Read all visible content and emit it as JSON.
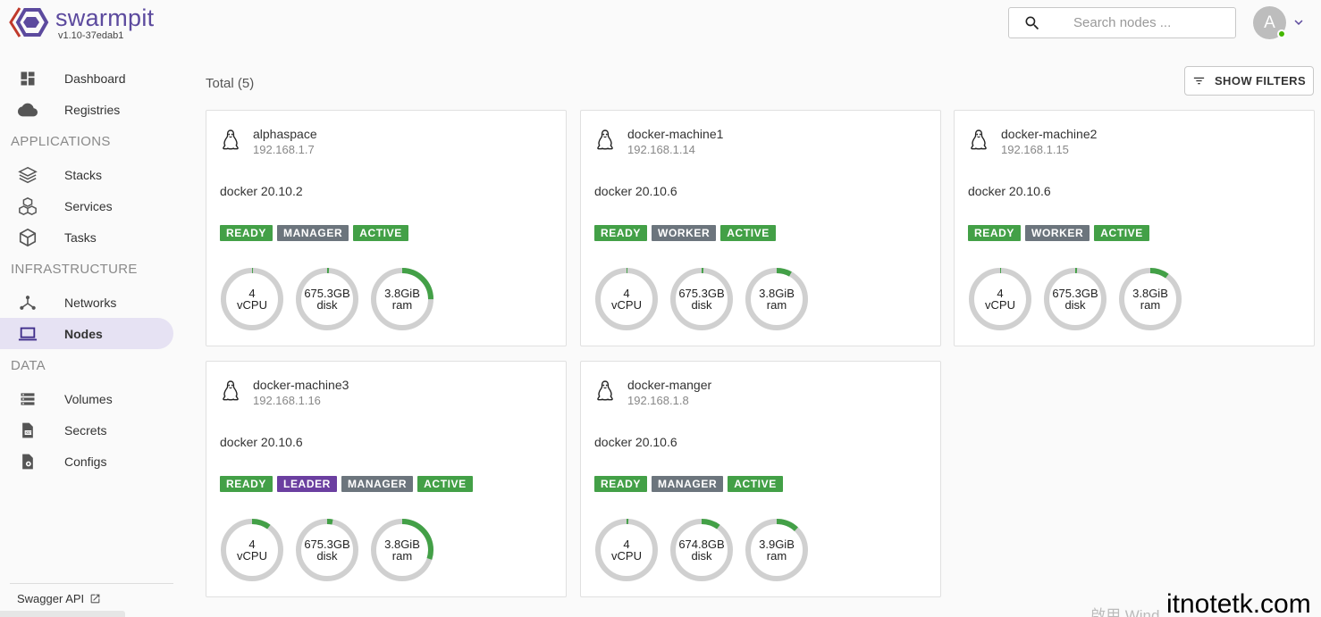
{
  "app": {
    "name": "swarmpit",
    "version": "v1.10-37edab1"
  },
  "sidebar": {
    "items": [
      {
        "type": "item",
        "label": "Dashboard",
        "icon": "dashboard-icon"
      },
      {
        "type": "item",
        "label": "Registries",
        "icon": "cloud-icon"
      },
      {
        "type": "section",
        "label": "APPLICATIONS"
      },
      {
        "type": "item",
        "label": "Stacks",
        "icon": "layers-icon"
      },
      {
        "type": "item",
        "label": "Services",
        "icon": "cubes-icon"
      },
      {
        "type": "item",
        "label": "Tasks",
        "icon": "cube-icon"
      },
      {
        "type": "section",
        "label": "INFRASTRUCTURE"
      },
      {
        "type": "item",
        "label": "Networks",
        "icon": "network-icon"
      },
      {
        "type": "item",
        "label": "Nodes",
        "icon": "laptop-icon",
        "active": true
      },
      {
        "type": "section",
        "label": "DATA"
      },
      {
        "type": "item",
        "label": "Volumes",
        "icon": "volumes-icon"
      },
      {
        "type": "item",
        "label": "Secrets",
        "icon": "secret-icon"
      },
      {
        "type": "item",
        "label": "Configs",
        "icon": "config-icon"
      }
    ],
    "footer_label": "Swagger API"
  },
  "search": {
    "placeholder": "Search nodes ..."
  },
  "user": {
    "initial": "A"
  },
  "main": {
    "total_label": "Total (5)",
    "filter_label": "SHOW FILTERS"
  },
  "colors": {
    "ready": "#43a047",
    "active": "#43a047",
    "manager": "#6c757d",
    "worker": "#6c757d",
    "leader": "#6b3fa0",
    "gauge_track": "#d0d0d0",
    "gauge_fill": "#43a047"
  },
  "nodes": [
    {
      "name": "alphaspace",
      "ip": "192.168.1.7",
      "engine": "docker 20.10.2",
      "labels": [
        "READY",
        "MANAGER",
        "ACTIVE"
      ],
      "gauges": [
        {
          "value": "4",
          "unit": "vCPU",
          "usage": 0.005
        },
        {
          "value": "675.3GB",
          "unit": "disk",
          "usage": 0.01
        },
        {
          "value": "3.8GiB",
          "unit": "ram",
          "usage": 0.25
        }
      ]
    },
    {
      "name": "docker-machine1",
      "ip": "192.168.1.14",
      "engine": "docker 20.10.6",
      "labels": [
        "READY",
        "WORKER",
        "ACTIVE"
      ],
      "gauges": [
        {
          "value": "4",
          "unit": "vCPU",
          "usage": 0.005
        },
        {
          "value": "675.3GB",
          "unit": "disk",
          "usage": 0.01
        },
        {
          "value": "3.8GiB",
          "unit": "ram",
          "usage": 0.08
        }
      ]
    },
    {
      "name": "docker-machine2",
      "ip": "192.168.1.15",
      "engine": "docker 20.10.6",
      "labels": [
        "READY",
        "WORKER",
        "ACTIVE"
      ],
      "gauges": [
        {
          "value": "4",
          "unit": "vCPU",
          "usage": 0.005
        },
        {
          "value": "675.3GB",
          "unit": "disk",
          "usage": 0.01
        },
        {
          "value": "3.8GiB",
          "unit": "ram",
          "usage": 0.1
        }
      ]
    },
    {
      "name": "docker-machine3",
      "ip": "192.168.1.16",
      "engine": "docker 20.10.6",
      "labels": [
        "READY",
        "LEADER",
        "MANAGER",
        "ACTIVE"
      ],
      "gauges": [
        {
          "value": "4",
          "unit": "vCPU",
          "usage": 0.1
        },
        {
          "value": "675.3GB",
          "unit": "disk",
          "usage": 0.03
        },
        {
          "value": "3.8GiB",
          "unit": "ram",
          "usage": 0.3
        }
      ]
    },
    {
      "name": "docker-manger",
      "ip": "192.168.1.8",
      "engine": "docker 20.10.6",
      "labels": [
        "READY",
        "MANAGER",
        "ACTIVE"
      ],
      "gauges": [
        {
          "value": "4",
          "unit": "vCPU",
          "usage": 0.01
        },
        {
          "value": "674.8GB",
          "unit": "disk",
          "usage": 0.1
        },
        {
          "value": "3.9GiB",
          "unit": "ram",
          "usage": 0.12
        }
      ]
    }
  ],
  "watermark": "itnotetk.com"
}
